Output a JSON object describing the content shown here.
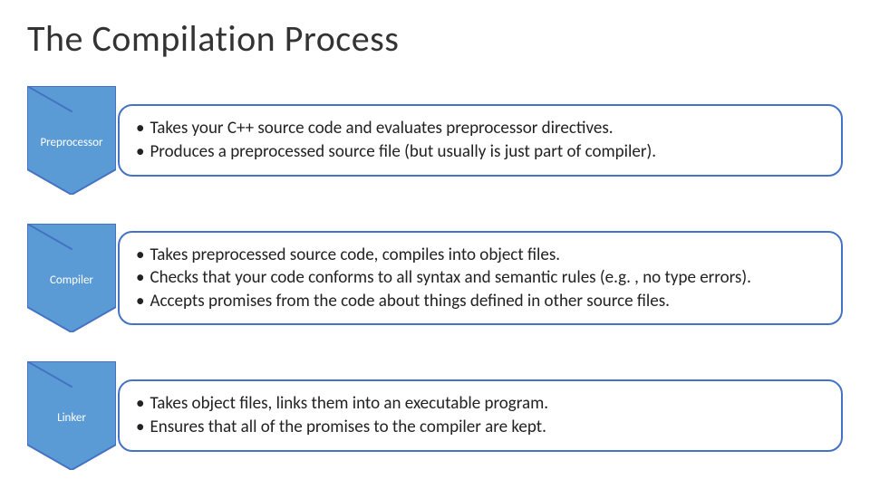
{
  "title": "The Compilation Process",
  "stages": [
    {
      "label": "Preprocessor",
      "bullets": [
        "Takes your C++ source code and evaluates preprocessor directives.",
        "Produces a preprocessed source file (but usually is just part of compiler)."
      ]
    },
    {
      "label": "Compiler",
      "bullets": [
        "Takes preprocessed source code, compiles into object files.",
        "Checks that your code conforms to all syntax and semantic rules (e.g. , no type errors).",
        "Accepts promises from the code about things defined in other source files."
      ]
    },
    {
      "label": "Linker",
      "bullets": [
        "Takes object files, links them into an executable program.",
        "Ensures that all of the promises to the compiler are kept."
      ]
    }
  ],
  "colors": {
    "shape_fill": "#5b9bd5",
    "shape_stroke": "#4472c4",
    "box_border": "#4472c4"
  }
}
